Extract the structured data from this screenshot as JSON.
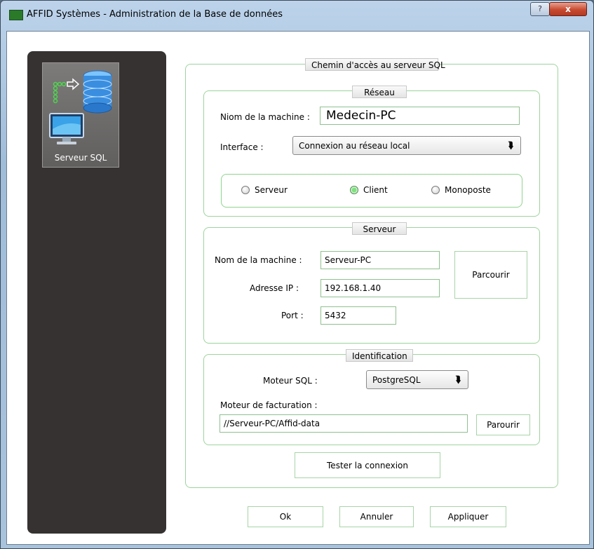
{
  "window": {
    "title": "AFFID Systèmes - Administration de la Base de données",
    "app_icon_text": "AFFID",
    "help_button": "?",
    "close_button": "x"
  },
  "sidebar": {
    "items": [
      {
        "label": "Serveur SQL",
        "icon": "database-server-icon"
      }
    ]
  },
  "main": {
    "title": "Chemin d'accès au serveur SQL",
    "reseau": {
      "legend": "Réseau",
      "machine_label": "Niom de la machine :",
      "machine_value": "Medecin-PC",
      "interface_label": "Interface :",
      "interface_value": "Connexion au réseau local",
      "modes": [
        {
          "label": "Serveur",
          "selected": false
        },
        {
          "label": "Client",
          "selected": true
        },
        {
          "label": "Monoposte",
          "selected": false
        }
      ]
    },
    "serveur": {
      "legend": "Serveur",
      "machine_label": "Nom de la machine :",
      "machine_value": "Serveur-PC",
      "ip_label": "Adresse IP :",
      "ip_value": "192.168.1.40",
      "port_label": "Port :",
      "port_value": "5432",
      "browse_button": "Parcourir"
    },
    "identification": {
      "legend": "Identification",
      "engine_label": "Moteur SQL :",
      "engine_value": "PostgreSQL",
      "billing_label": "Moteur de facturation :",
      "billing_value": "//Serveur-PC/Affid-data",
      "browse_button": "Parourir"
    },
    "test_button": "Tester la connexion"
  },
  "footer": {
    "ok": "Ok",
    "cancel": "Annuler",
    "apply": "Appliquer"
  }
}
